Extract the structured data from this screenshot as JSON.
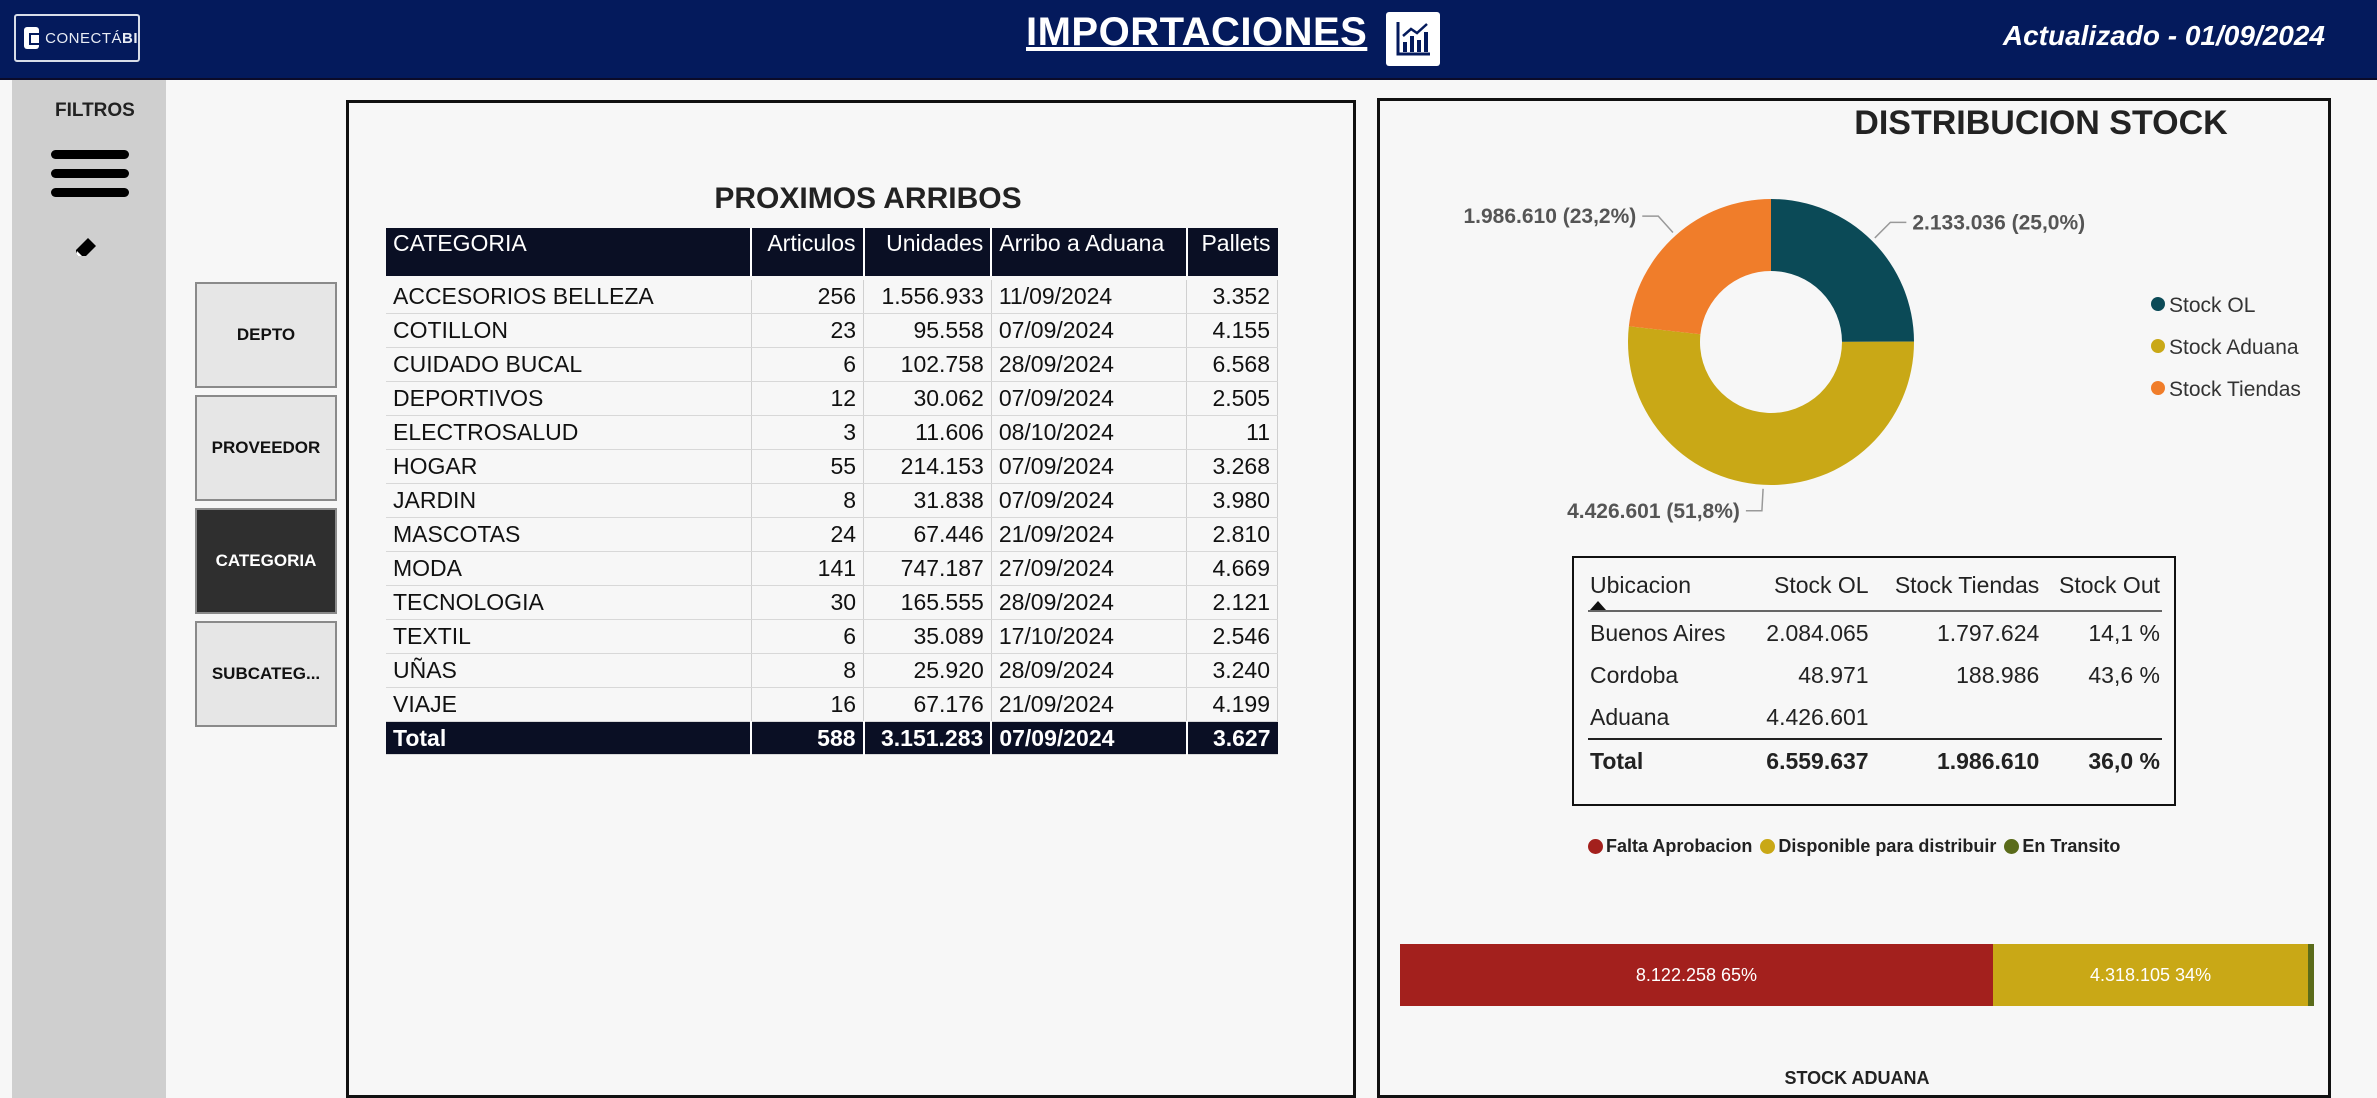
{
  "header": {
    "logo_text": "CONECTÁ",
    "logo_bold": "BI",
    "title": "IMPORTACIONES",
    "updated": "Actualizado - 01/09/2024"
  },
  "sidebar": {
    "label": "FILTROS",
    "filters": [
      "DEPTO",
      "PROVEEDOR",
      "CATEGORIA",
      "SUBCATEG..."
    ],
    "active_filter": "CATEGORIA"
  },
  "arribos": {
    "title": "PROXIMOS ARRIBOS",
    "columns": [
      "CATEGORIA",
      "Articulos",
      "Unidades",
      "Arribo a Aduana",
      "Pallets"
    ],
    "rows": [
      [
        "ACCESORIOS BELLEZA",
        "256",
        "1.556.933",
        "11/09/2024",
        "3.352"
      ],
      [
        "COTILLON",
        "23",
        "95.558",
        "07/09/2024",
        "4.155"
      ],
      [
        "CUIDADO BUCAL",
        "6",
        "102.758",
        "28/09/2024",
        "6.568"
      ],
      [
        "DEPORTIVOS",
        "12",
        "30.062",
        "07/09/2024",
        "2.505"
      ],
      [
        "ELECTROSALUD",
        "3",
        "11.606",
        "08/10/2024",
        "11"
      ],
      [
        "HOGAR",
        "55",
        "214.153",
        "07/09/2024",
        "3.268"
      ],
      [
        "JARDIN",
        "8",
        "31.838",
        "07/09/2024",
        "3.980"
      ],
      [
        "MASCOTAS",
        "24",
        "67.446",
        "21/09/2024",
        "2.810"
      ],
      [
        "MODA",
        "141",
        "747.187",
        "27/09/2024",
        "4.669"
      ],
      [
        "TECNOLOGIA",
        "30",
        "165.555",
        "28/09/2024",
        "2.121"
      ],
      [
        "TEXTIL",
        "6",
        "35.089",
        "17/10/2024",
        "2.546"
      ],
      [
        "UÑAS",
        "8",
        "25.920",
        "28/09/2024",
        "3.240"
      ],
      [
        "VIAJE",
        "16",
        "67.176",
        "21/09/2024",
        "4.199"
      ]
    ],
    "total": [
      "Total",
      "588",
      "3.151.283",
      "07/09/2024",
      "3.627"
    ]
  },
  "distribucion": {
    "title": "DISTRIBUCION STOCK"
  },
  "chart_data": [
    {
      "type": "pie",
      "title": "DISTRIBUCION STOCK",
      "donut": true,
      "legend_position": "right",
      "series": [
        {
          "name": "Stock OL",
          "value": 2133036,
          "label": "2.133.036 (25,0%)",
          "color": "#0b4a57"
        },
        {
          "name": "Stock Aduana",
          "value": 4426601,
          "label": "4.426.601 (51,8%)",
          "color": "#c9a816"
        },
        {
          "name": "Stock Tiendas",
          "value": 1986610,
          "label": "1.986.610 (23,2%)",
          "color": "#f07d2a"
        }
      ]
    },
    {
      "type": "bar",
      "orientation": "horizontal-stacked",
      "title": "STOCK ADUANA",
      "legend_position": "top",
      "series": [
        {
          "name": "Falta Aprobacion",
          "value": 8122258,
          "label": "8.122.258 65%",
          "color": "#a3201d"
        },
        {
          "name": "Disponible para distribuir",
          "value": 4318105,
          "label": "4.318.105 34%",
          "color": "#c9a816"
        },
        {
          "name": "En Transito",
          "value": 80000,
          "label": "",
          "color": "#5a6b1a"
        }
      ]
    }
  ],
  "stock_table": {
    "columns": [
      "Ubicacion",
      "Stock OL",
      "Stock Tiendas",
      "Stock Out"
    ],
    "rows": [
      [
        "Buenos Aires",
        "2.084.065",
        "1.797.624",
        "14,1 %"
      ],
      [
        "Cordoba",
        "48.971",
        "188.986",
        "43,6 %"
      ],
      [
        "Aduana",
        "4.426.601",
        "",
        ""
      ]
    ],
    "total": [
      "Total",
      "6.559.637",
      "1.986.610",
      "36,0 %"
    ]
  }
}
